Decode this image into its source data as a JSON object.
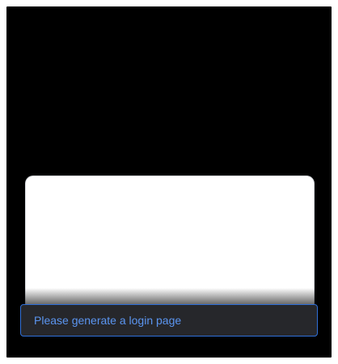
{
  "heading": "",
  "description": "",
  "prompt": {
    "text": "Please generate a login page"
  },
  "colors": {
    "background": "#000000",
    "preview_surface": "#ffffff",
    "prompt_surface": "#26272b",
    "prompt_border": "#2f6fd8",
    "prompt_text": "#5b95f0"
  }
}
